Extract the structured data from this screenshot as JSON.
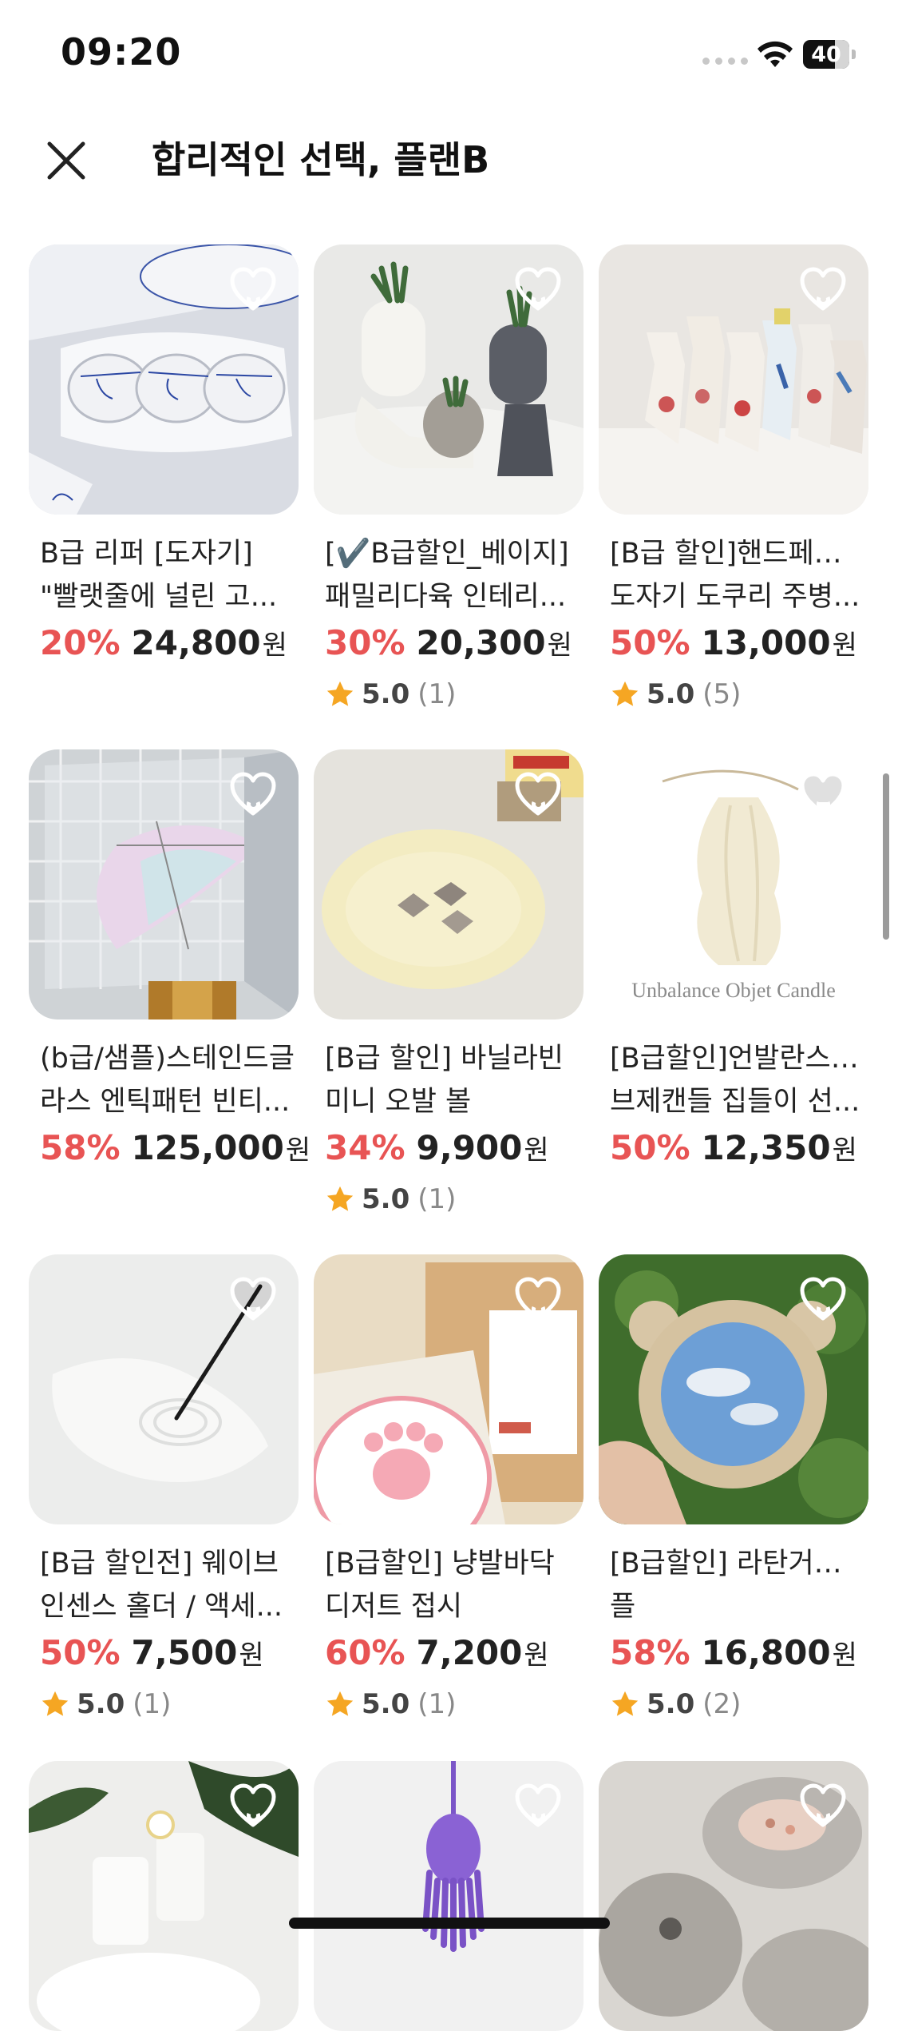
{
  "status": {
    "time": "09:20",
    "battery": "40"
  },
  "header": {
    "title": "합리적인 선택, 플랜B"
  },
  "products": [
    {
      "name": [
        "B급 리퍼 [도자기]",
        "\"빨랫줄에 널린 고..."
      ],
      "discount": "20%",
      "price": "24,800",
      "currency": "원",
      "rating": "",
      "reviews": "",
      "image": "ceramic-tray-blue-drawing"
    },
    {
      "name": [
        "[✔️B급할인_베이지]",
        "패밀리다육 인테리..."
      ],
      "discount": "30%",
      "price": "20,300",
      "currency": "원",
      "rating": "5.0",
      "reviews": "(1)",
      "image": "face-succulent-planters"
    },
    {
      "name": [
        "[B급 할인]핸드페인팅",
        "도자기 도쿠리 주병..."
      ],
      "discount": "50%",
      "price": "13,000",
      "currency": "원",
      "rating": "5.0",
      "reviews": "(5)",
      "image": "hand-painted-sake-bottles"
    },
    {
      "name": [
        "(b급/샘플)스테인드글",
        "라스 엔틱패턴 빈티..."
      ],
      "discount": "58%",
      "price": "125,000",
      "currency": "원",
      "rating": "",
      "reviews": "",
      "image": "stained-glass-lamp"
    },
    {
      "name": [
        "[B급 할인] 바닐라빈",
        "미니 오발 볼"
      ],
      "discount": "34%",
      "price": "9,900",
      "currency": "원",
      "rating": "5.0",
      "reviews": "(1)",
      "image": "vanilla-oval-bowl"
    },
    {
      "name": [
        "[B급할인]언발란스 오",
        "브제캔들 집들이 선..."
      ],
      "discount": "50%",
      "price": "12,350",
      "currency": "원",
      "rating": "",
      "reviews": "",
      "image": "unbalance-objet-candle",
      "image_caption": "Unbalance Objet Candle"
    },
    {
      "name": [
        "[B급 할인전] 웨이브",
        "인센스 홀더 / 액세..."
      ],
      "discount": "50%",
      "price": "7,500",
      "currency": "원",
      "rating": "5.0",
      "reviews": "(1)",
      "image": "wave-incense-holder"
    },
    {
      "name": [
        "[B급할인] 냥발바닥",
        "디저트 접시"
      ],
      "discount": "60%",
      "price": "7,200",
      "currency": "원",
      "rating": "5.0",
      "reviews": "(1)",
      "image": "cat-paw-dessert-plate"
    },
    {
      "name": [
        "[B급할인] 라탄거울샘",
        "플"
      ],
      "discount": "58%",
      "price": "16,800",
      "currency": "원",
      "rating": "5.0",
      "reviews": "(2)",
      "image": "rattan-mirror"
    },
    {
      "name": [],
      "discount": "",
      "price": "",
      "currency": "",
      "rating": "",
      "reviews": "",
      "image": "white-cups-flowers"
    },
    {
      "name": [],
      "discount": "",
      "price": "",
      "currency": "",
      "rating": "",
      "reviews": "",
      "image": "purple-tassel"
    },
    {
      "name": [],
      "discount": "",
      "price": "",
      "currency": "",
      "rating": "",
      "reviews": "",
      "image": "stone-salt-holders"
    }
  ],
  "colors": {
    "discount": "#e85454",
    "star": "#f5a623",
    "heart": "#ffffff"
  },
  "icons": {
    "close": "close-icon",
    "wishlist": "heart-outline-icon",
    "rating": "star-icon"
  }
}
